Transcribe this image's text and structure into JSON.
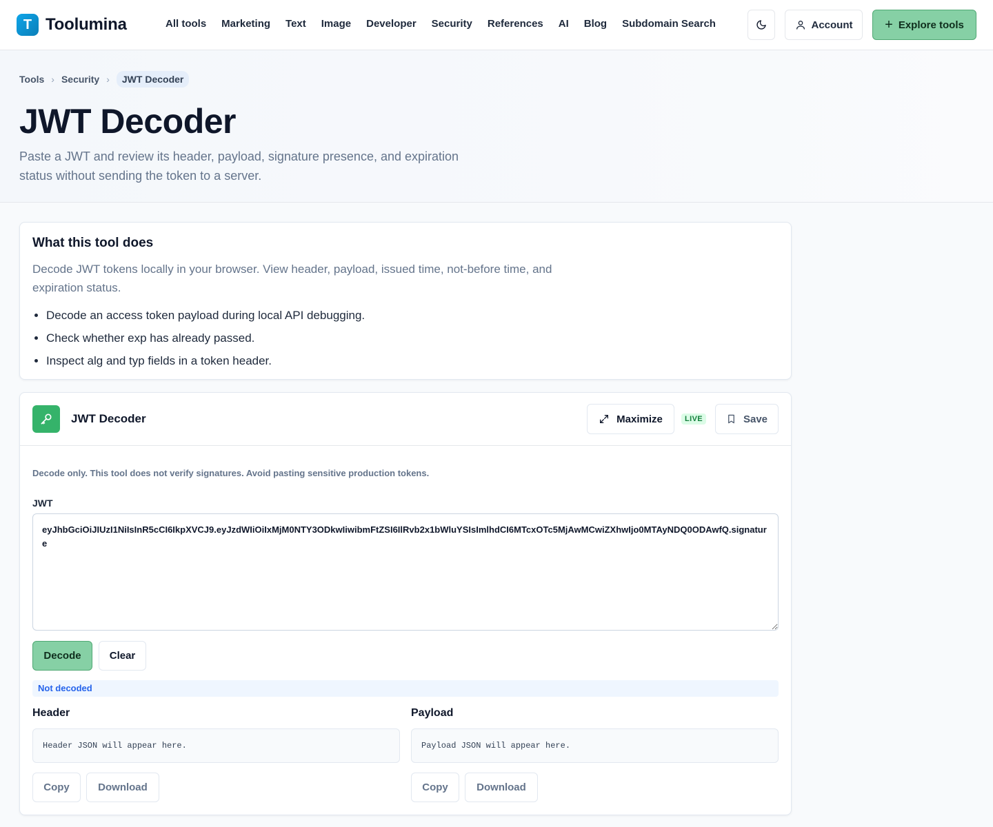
{
  "brand": {
    "letter": "T",
    "name": "Toolumina"
  },
  "nav": [
    "All tools",
    "Marketing",
    "Text",
    "Image",
    "Developer",
    "Security",
    "References",
    "AI",
    "Blog",
    "Subdomain Search"
  ],
  "header": {
    "account_label": "Account",
    "explore_label": "Explore tools",
    "explore_plus": "+"
  },
  "breadcrumb": {
    "items": [
      "Tools",
      "Security"
    ],
    "current": "JWT Decoder",
    "separator": "›"
  },
  "page": {
    "title": "JWT Decoder",
    "subtitle": "Paste a JWT and review its header, payload, signature presence, and expiration status without sending the token to a server."
  },
  "info": {
    "title": "What this tool does",
    "description": "Decode JWT tokens locally in your browser. View header, payload, issued time, not-before time, and expiration status.",
    "bullets": [
      "Decode an access token payload during local API debugging.",
      "Check whether exp has already passed.",
      "Inspect alg and typ fields in a token header."
    ]
  },
  "tool": {
    "name": "JWT Decoder",
    "maximize_label": "Maximize",
    "live_badge": "LIVE",
    "save_label": "Save",
    "notice": "Decode only. This tool does not verify signatures. Avoid pasting sensitive production tokens.",
    "input_label": "JWT",
    "input_value": "eyJhbGciOiJIUzI1NiIsInR5cCI6IkpXVCJ9.eyJzdWIiOiIxMjM0NTY3ODkwIiwibmFtZSI6IlRvb2x1bWluYSIsImlhdCI6MTcxOTc5MjAwMCwiZXhwIjo0MTAyNDQ0ODAwfQ.signature",
    "decode_label": "Decode",
    "clear_label": "Clear",
    "status": "Not decoded",
    "header_label": "Header",
    "header_placeholder": "Header JSON will appear here.",
    "payload_label": "Payload",
    "payload_placeholder": "Payload JSON will appear here.",
    "copy_label": "Copy",
    "download_label": "Download"
  },
  "colors": {
    "accent_green": "#86d0a5",
    "brand_blue": "#0ea5e9",
    "status_blue": "#2563eb"
  }
}
